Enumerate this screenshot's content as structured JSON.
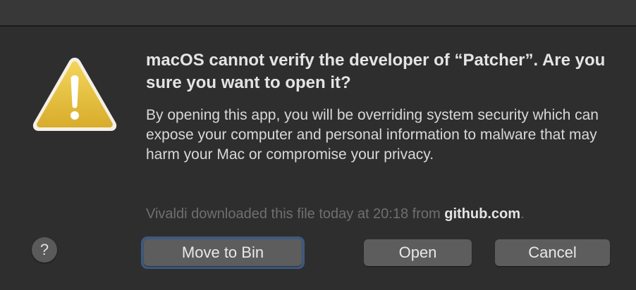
{
  "dialog": {
    "title": "macOS cannot verify the developer of “Patcher”. Are you sure you want to open it?",
    "body": "By opening this app, you will be overriding system security which can expose your computer and personal information to malware that may harm your Mac or compromise your privacy.",
    "source_prefix": "Vivaldi downloaded this file today at 20:18 from ",
    "source_domain": "github.com",
    "source_suffix": ".",
    "icon": "warning-triangle-icon"
  },
  "buttons": {
    "help_label": "?",
    "move_to_bin_label": "Move to Bin",
    "open_label": "Open",
    "cancel_label": "Cancel"
  },
  "colors": {
    "background": "#2e2e2e",
    "warning_yellow": "#e6c040",
    "focus_ring": "#3e5a7c"
  }
}
